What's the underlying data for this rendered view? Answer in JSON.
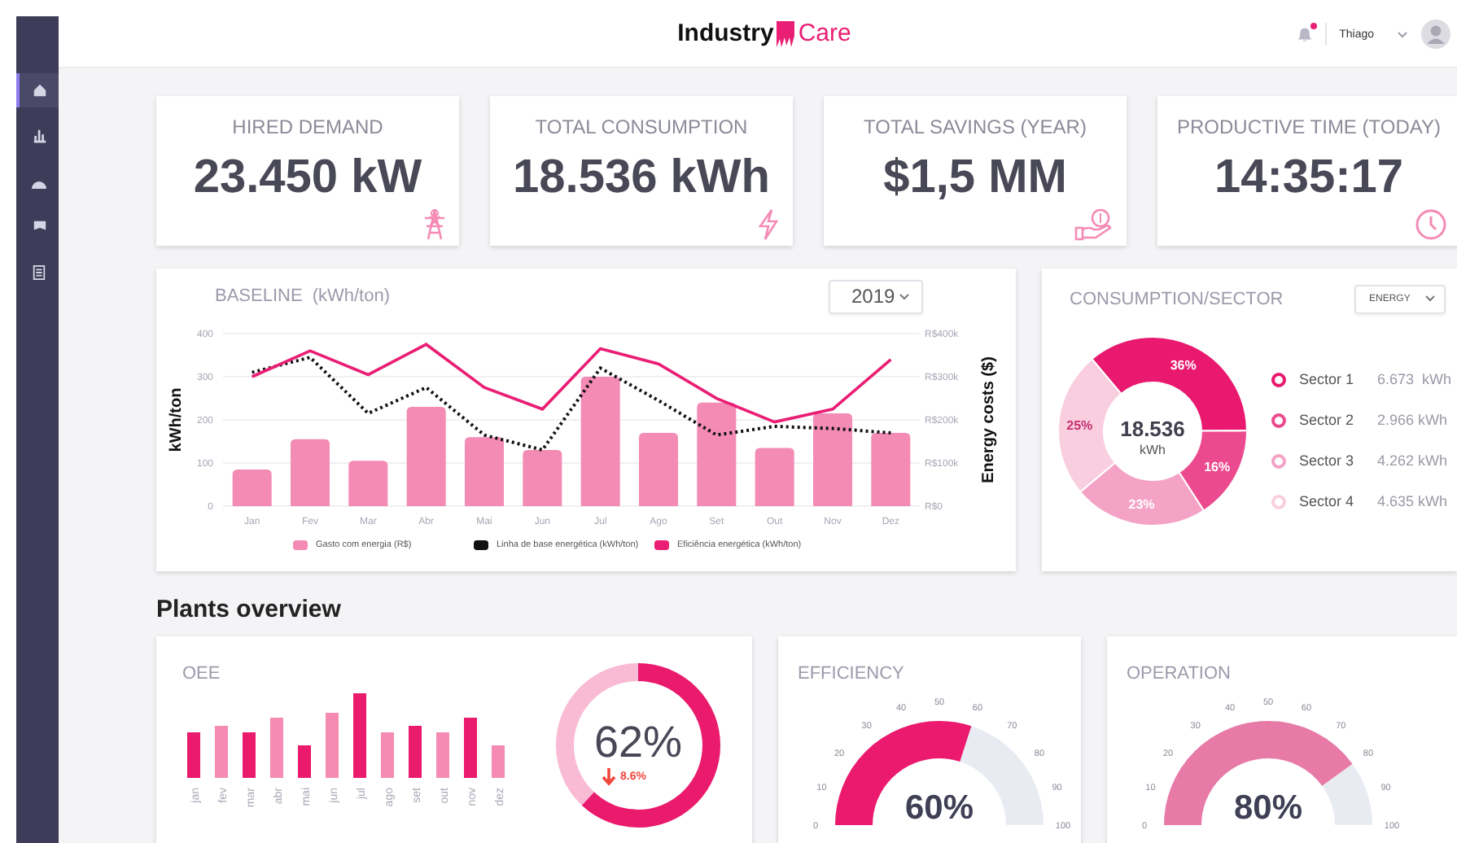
{
  "header": {
    "logo_bold": "Industry",
    "logo_light": "Care",
    "user": "Thiago",
    "notification": true
  },
  "sidebar": {
    "items": [
      {
        "kind": "home",
        "selected": true
      },
      {
        "kind": "chart",
        "selected": false
      },
      {
        "kind": "gauge",
        "selected": false
      },
      {
        "kind": "flag",
        "selected": false
      },
      {
        "kind": "list",
        "selected": false
      }
    ]
  },
  "kpis": [
    {
      "title": "HIRED DEMAND",
      "value": "23.450 kW",
      "kind": "tower"
    },
    {
      "title": "TOTAL CONSUMPTION",
      "value": "18.536 kWh",
      "kind": "bolt"
    },
    {
      "title": "TOTAL SAVINGS (YEAR)",
      "value": "$1,5 MM",
      "kind": "money"
    },
    {
      "title": "PRODUCTIVE TIME (TODAY)",
      "value": "14:35:17",
      "kind": "clock"
    }
  ],
  "baseline": {
    "title": "BASELINE",
    "unit": "(kWh/ton)",
    "year": "2019",
    "chart_data": {
      "type": "bar",
      "ylabel": "kWh/ton",
      "y2label": "Energy costs ($)",
      "categories": [
        "Jan",
        "Fev",
        "Mar",
        "Abr",
        "Mai",
        "Jun",
        "Jul",
        "Ago",
        "Set",
        "Out",
        "Nov",
        "Dez"
      ],
      "ylim": [
        0,
        400
      ],
      "yticks": [
        0,
        100,
        200,
        300,
        400
      ],
      "grid": true,
      "y2ticks": [
        "R$0",
        "R$100k",
        "R$200k",
        "R$300k",
        "R$400k"
      ],
      "series": [
        {
          "name": "Gasto com energia (R$)",
          "type": "bar",
          "color": "#f48bb4",
          "values": [
            85,
            155,
            105,
            230,
            160,
            130,
            300,
            170,
            240,
            135,
            215,
            170
          ]
        },
        {
          "name": "Linha de base energética (kWh/ton)",
          "type": "line",
          "line_style": "dotted",
          "color": "#111111",
          "values": [
            310,
            345,
            215,
            275,
            165,
            130,
            320,
            245,
            165,
            185,
            180,
            170
          ]
        },
        {
          "name": "Eficiência energética (kWh/ton)",
          "type": "line",
          "line_style": "solid",
          "color": "#e91e74",
          "values": [
            300,
            360,
            305,
            375,
            275,
            225,
            365,
            330,
            250,
            195,
            225,
            340
          ]
        }
      ]
    }
  },
  "consumption": {
    "title": "CONSUMPTION/SECTOR",
    "filter": "ENERGY",
    "total": "18.536",
    "unit": "kWh",
    "chart_data": {
      "type": "donut",
      "categories": [
        "Sector 1",
        "Sector 2",
        "Sector 3",
        "Sector 4"
      ],
      "values": [
        36,
        16,
        23,
        25
      ],
      "value_labels": [
        "36%",
        "16%",
        "23%",
        "25%"
      ]
    },
    "sectors": [
      {
        "reading": "6.673  kWh",
        "color": "#e8196f"
      },
      {
        "reading": "2.966 kWh",
        "color": "#ec4a8f"
      },
      {
        "reading": "4.262 kWh",
        "color": "#f4a3c6"
      },
      {
        "reading": "4.635 kWh",
        "color": "#f9cfe0"
      }
    ]
  },
  "plants": {
    "heading": "Plants overview",
    "oee": {
      "title": "OEE",
      "months": [
        {
          "label": "jan",
          "color": "#ea1a6d"
        },
        {
          "label": "fev",
          "color": "#f58ab3"
        },
        {
          "label": "mar",
          "color": "#ea1a6d"
        },
        {
          "label": "abr",
          "color": "#f58ab3"
        },
        {
          "label": "mai",
          "color": "#ea1a6d"
        },
        {
          "label": "jun",
          "color": "#f58ab3"
        },
        {
          "label": "jul",
          "color": "#ea1a6d"
        },
        {
          "label": "ago",
          "color": "#f58ab3"
        },
        {
          "label": "set",
          "color": "#ea1a6d"
        },
        {
          "label": "out",
          "color": "#f58ab3"
        },
        {
          "label": "nov",
          "color": "#ea1a6d"
        },
        {
          "label": "dez",
          "color": "#f58ab3"
        }
      ],
      "ring": {
        "value": "62%",
        "level": 0.62,
        "change": "8.6%"
      }
    },
    "gauges": [
      {
        "title": "EFFICIENCY",
        "value": "60%",
        "level": 0.6,
        "color": "#ec1a6e",
        "ticks": [
          "0",
          "10",
          "20",
          "30",
          "40",
          "50",
          "60",
          "70",
          "80",
          "90",
          "100"
        ]
      },
      {
        "title": "OPERATION",
        "value": "80%",
        "level": 0.8,
        "color": "#e87aa7",
        "ticks": [
          "0",
          "10",
          "20",
          "30",
          "40",
          "50",
          "60",
          "70",
          "80",
          "90",
          "100"
        ]
      }
    ]
  }
}
